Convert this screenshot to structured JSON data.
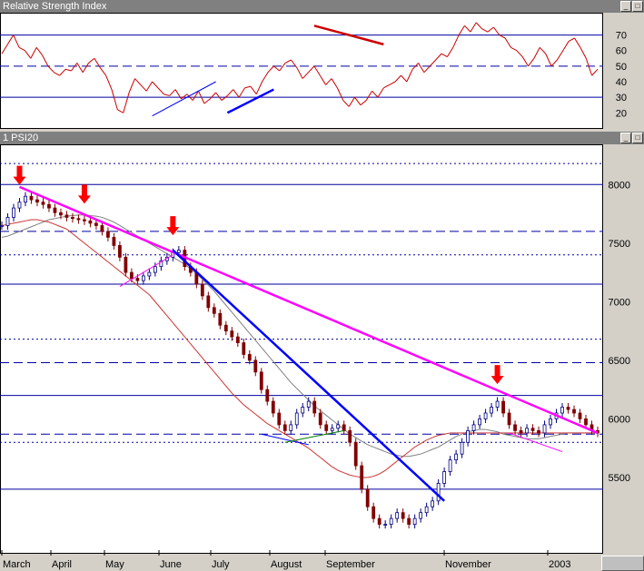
{
  "rsi_panel": {
    "title": "Relative Strength Index",
    "ticks": [
      20,
      30,
      40,
      50,
      60,
      70
    ],
    "ylim": [
      12,
      82
    ],
    "hlines": [
      {
        "v": 70,
        "style": "solid"
      },
      {
        "v": 50,
        "style": "dashed"
      },
      {
        "v": 30,
        "style": "solid"
      }
    ]
  },
  "price_panel": {
    "title": "1 PSI20",
    "ticks": [
      5500,
      6000,
      6500,
      7000,
      7500,
      8000
    ],
    "ylim": [
      4880,
      8320
    ]
  },
  "x_axis_labels": [
    "March",
    "April",
    "May",
    "June",
    "July",
    "August",
    "September",
    "November",
    "2003"
  ],
  "colors": {
    "price_up": "#000080",
    "price_down": "#800000",
    "rsi_line": "#cc0000",
    "long_ma": "#cc3333",
    "short_ma": "#808080",
    "main_trendline": "#ff00ff",
    "down_trendline": "#0000ff",
    "arrow": "#ff0000",
    "support_line": "#008000"
  },
  "chart_data": [
    {
      "type": "line",
      "title": "Relative Strength Index",
      "ylim": [
        12,
        82
      ],
      "series": [
        {
          "values": [
            58,
            64,
            70,
            62,
            60,
            55,
            62,
            57,
            50,
            46,
            44,
            48,
            47,
            52,
            46,
            52,
            55,
            49,
            44,
            35,
            22,
            20,
            33,
            42,
            38,
            34,
            40,
            36,
            32,
            31,
            35,
            29,
            32,
            28,
            34,
            26,
            29,
            33,
            28,
            31,
            35,
            30,
            36,
            37,
            32,
            40,
            46,
            50,
            47,
            52,
            54,
            49,
            42,
            46,
            50,
            44,
            38,
            42,
            36,
            28,
            24,
            30,
            25,
            28,
            34,
            30,
            36,
            38,
            40,
            44,
            40,
            48,
            52,
            46,
            50,
            54,
            58,
            56,
            62,
            70,
            76,
            72,
            78,
            74,
            72,
            75,
            70,
            68,
            62,
            60,
            56,
            50,
            55,
            62,
            58,
            50,
            54,
            60,
            66,
            68,
            62,
            55,
            44,
            48
          ]
        }
      ],
      "annotations": {
        "trendlines": [
          {
            "color": "blue",
            "from": [
              26,
              18
            ],
            "to": [
              37,
              40
            ],
            "thick": false
          },
          {
            "color": "blue",
            "from": [
              39,
              20
            ],
            "to": [
              47,
              35
            ],
            "thick": true
          },
          {
            "color": "red",
            "from": [
              54,
              76
            ],
            "to": [
              66,
              64
            ],
            "thick": true
          }
        ]
      }
    },
    {
      "type": "line",
      "title": "1 PSI20",
      "ylim": [
        4880,
        8320
      ],
      "series": [
        {
          "name": "",
          "values": [
            7650,
            7720,
            7800,
            7850,
            7900,
            7870,
            7850,
            7830,
            7800,
            7760,
            7740,
            7720,
            7710,
            7700,
            7690,
            7670,
            7650,
            7600,
            7550,
            7480,
            7380,
            7250,
            7200,
            7180,
            7220,
            7250,
            7300,
            7350,
            7380,
            7420,
            7440,
            7300,
            7250,
            7150,
            7050,
            6950,
            6900,
            6800,
            6750,
            6700,
            6650,
            6550,
            6500,
            6400,
            6250,
            6150,
            6050,
            5950,
            5900,
            5950,
            6050,
            6100,
            6150,
            6050,
            5950,
            5900,
            5920,
            5950,
            5900,
            5800,
            5600,
            5400,
            5250,
            5150,
            5100,
            5100,
            5150,
            5200,
            5150,
            5100,
            5150,
            5200,
            5250,
            5300,
            5450,
            5550,
            5650,
            5700,
            5800,
            5900,
            5950,
            6000,
            6050,
            6100,
            6150,
            6050,
            5950,
            5900,
            5880,
            5920,
            5900,
            5880,
            5950,
            6000,
            6050,
            6100,
            6080,
            6050,
            6000,
            5950,
            5900,
            5880
          ]
        },
        {
          "name": "",
          "values": [
            7550,
            7560,
            7580,
            7600,
            7620,
            7640,
            7660,
            7680,
            7700,
            7710,
            7720,
            7730,
            7735,
            7740,
            7740,
            7735,
            7730,
            7720,
            7700,
            7680,
            7650,
            7620,
            7590,
            7560,
            7530,
            7500,
            7470,
            7440,
            7410,
            7380,
            7350,
            7320,
            7280,
            7240,
            7190,
            7140,
            7090,
            7030,
            6970,
            6910,
            6850,
            6790,
            6730,
            6670,
            6610,
            6550,
            6490,
            6430,
            6370,
            6310,
            6260,
            6210,
            6160,
            6110,
            6070,
            6030,
            5990,
            5950,
            5910,
            5870,
            5840,
            5810,
            5780,
            5760,
            5740,
            5720,
            5700,
            5690,
            5680,
            5680,
            5690,
            5700,
            5720,
            5740,
            5760,
            5790,
            5820,
            5850,
            5870,
            5890,
            5900,
            5910,
            5910,
            5900,
            5890,
            5870,
            5860,
            5850,
            5840,
            5830,
            5830,
            5830,
            5840,
            5850,
            5860,
            5870,
            5880,
            5880,
            5880,
            5880,
            5880,
            5880
          ]
        },
        {
          "name": "",
          "values": [
            7650,
            7660,
            7670,
            7680,
            7690,
            7700,
            7700,
            7690,
            7680,
            7660,
            7640,
            7620,
            7580,
            7540,
            7500,
            7460,
            7420,
            7380,
            7340,
            7300,
            7260,
            7220,
            7180,
            7140,
            7100,
            7060,
            7000,
            6940,
            6880,
            6820,
            6760,
            6700,
            6640,
            6580,
            6520,
            6460,
            6400,
            6340,
            6280,
            6220,
            6170,
            6120,
            6080,
            6040,
            6000,
            5960,
            5930,
            5900,
            5870,
            5840,
            5810,
            5780,
            5750,
            5710,
            5670,
            5630,
            5590,
            5560,
            5540,
            5520,
            5510,
            5500,
            5500,
            5510,
            5530,
            5560,
            5600,
            5640,
            5680,
            5720,
            5760,
            5790,
            5820,
            5840,
            5860,
            5870,
            5880,
            5880,
            5880,
            5880,
            5880,
            5880,
            5880,
            5880,
            5880,
            5880,
            5880,
            5880,
            5880,
            5880,
            5880,
            5880,
            5880,
            5880,
            5880,
            5880,
            5880,
            5880,
            5880,
            5880,
            5880,
            5880
          ]
        }
      ],
      "annotations": {
        "arrows_at_index": [
          3,
          14,
          29,
          84
        ],
        "main_trendline": {
          "from": [
            3,
            7980
          ],
          "to": [
            101,
            5880
          ]
        },
        "down_trendline": {
          "from": [
            29,
            7440
          ],
          "to": [
            75,
            5300
          ]
        }
      }
    }
  ]
}
